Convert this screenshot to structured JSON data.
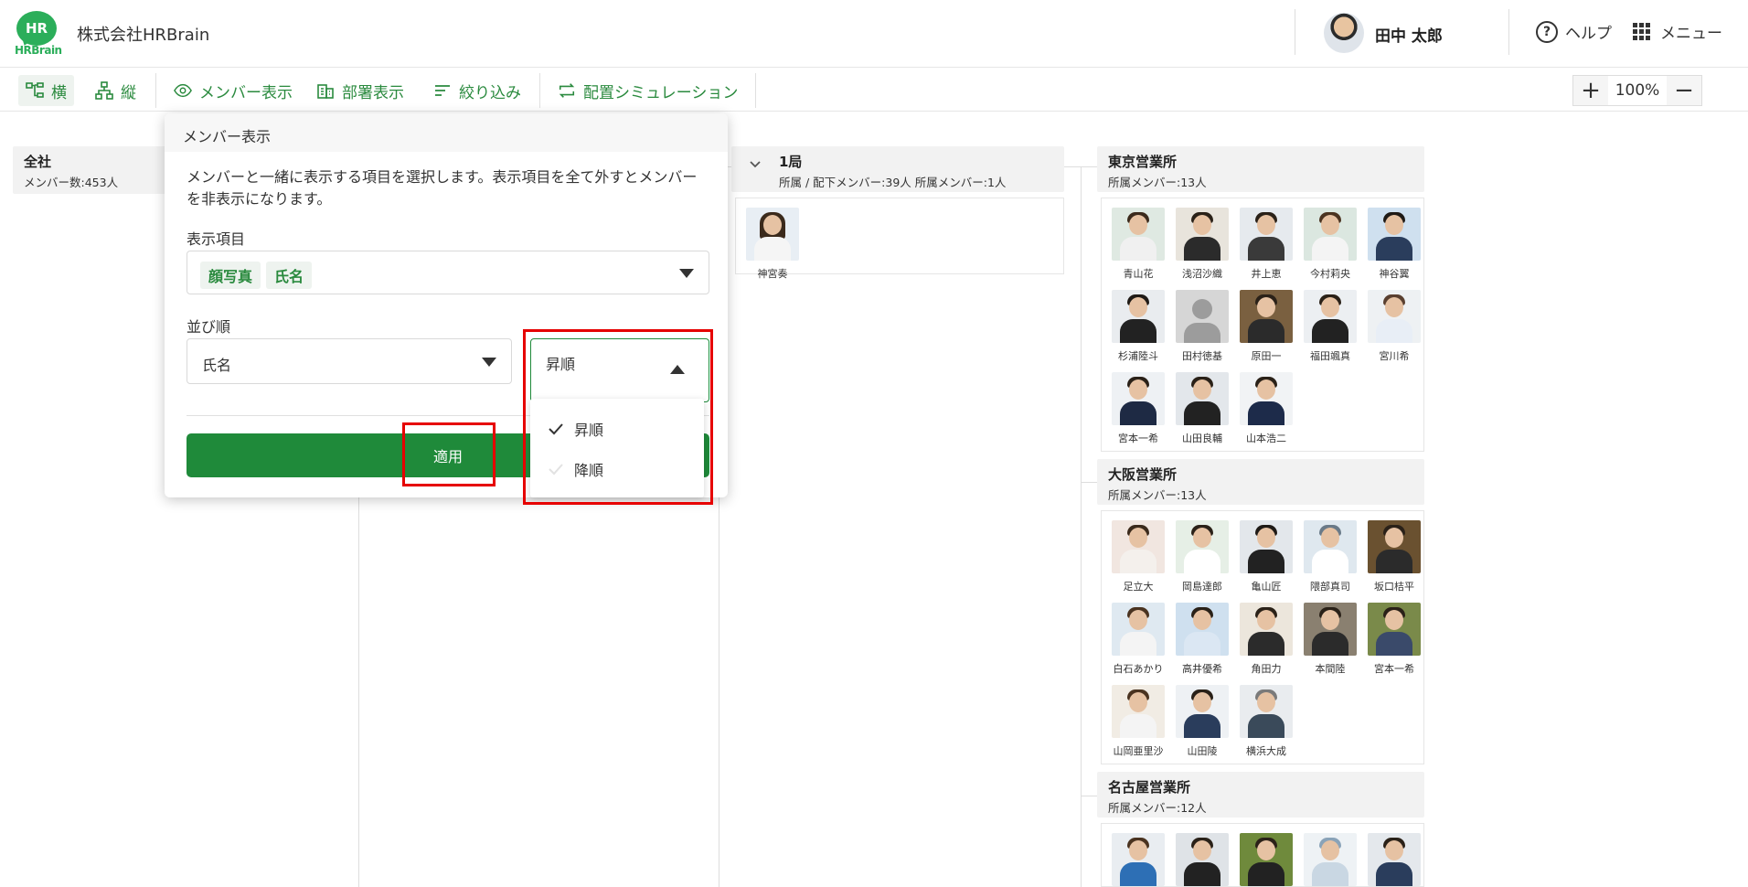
{
  "header": {
    "logo_mark": "HR",
    "logo_brand": "HRBrain",
    "company": "株式会社HRBrain",
    "user_name": "田中 太郎",
    "help_label": "ヘルプ",
    "menu_label": "メニュー"
  },
  "toolbar": {
    "items": [
      {
        "label": "横",
        "icon": "horizontal-tree-icon"
      },
      {
        "label": "縦",
        "icon": "vertical-tree-icon"
      },
      {
        "label": "メンバー表示",
        "icon": "eye-icon"
      },
      {
        "label": "部署表示",
        "icon": "building-icon"
      },
      {
        "label": "絞り込み",
        "icon": "filter-lines-icon"
      },
      {
        "label": "配置シミュレーション",
        "icon": "swap-arrows-icon"
      }
    ],
    "zoom": "100%",
    "zoom_in": "+",
    "zoom_out": "−"
  },
  "org": {
    "root": {
      "title": "全社",
      "sub": "メンバー数:453人"
    },
    "level1": {
      "title": "1局",
      "sub": "所属 / 配下メンバー:39人 所属メンバー:1人",
      "members": [
        "神宮奏"
      ]
    },
    "branches": [
      {
        "title": "東京営業所",
        "sub": "所属メンバー:13人",
        "members": [
          "青山花",
          "浅沼沙織",
          "井上恵",
          "今村莉央",
          "神谷翼",
          "杉浦陸斗",
          "田村徳基",
          "原田一",
          "福田颯真",
          "宮川希",
          "宮本一希",
          "山田良輔",
          "山本浩二"
        ]
      },
      {
        "title": "大阪営業所",
        "sub": "所属メンバー:13人",
        "members": [
          "足立大",
          "岡島達郎",
          "亀山匠",
          "隈部真司",
          "坂口桔平",
          "白石あかり",
          "高井優希",
          "角田力",
          "本間陸",
          "宮本一希",
          "山岡亜里沙",
          "山田陵",
          "横浜大成"
        ]
      },
      {
        "title": "名古屋営業所",
        "sub": "所属メンバー:12人",
        "members": []
      }
    ]
  },
  "popup": {
    "title": "メンバー表示",
    "description": "メンバーと一緒に表示する項目を選択します。表示項目を全て外すとメンバーを非表示になります。",
    "display_items_label": "表示項目",
    "display_items": [
      "顔写真",
      "氏名"
    ],
    "sort_label": "並び順",
    "sort_field": "氏名",
    "sort_order": "昇順",
    "sort_options": [
      "昇順",
      "降順"
    ],
    "apply_label": "適用"
  },
  "colors": {
    "brand_green": "#2bae5a",
    "toolbar_green": "#2a8a3e",
    "apply_button": "#1f8a3a",
    "annotation_red": "#e60000"
  }
}
